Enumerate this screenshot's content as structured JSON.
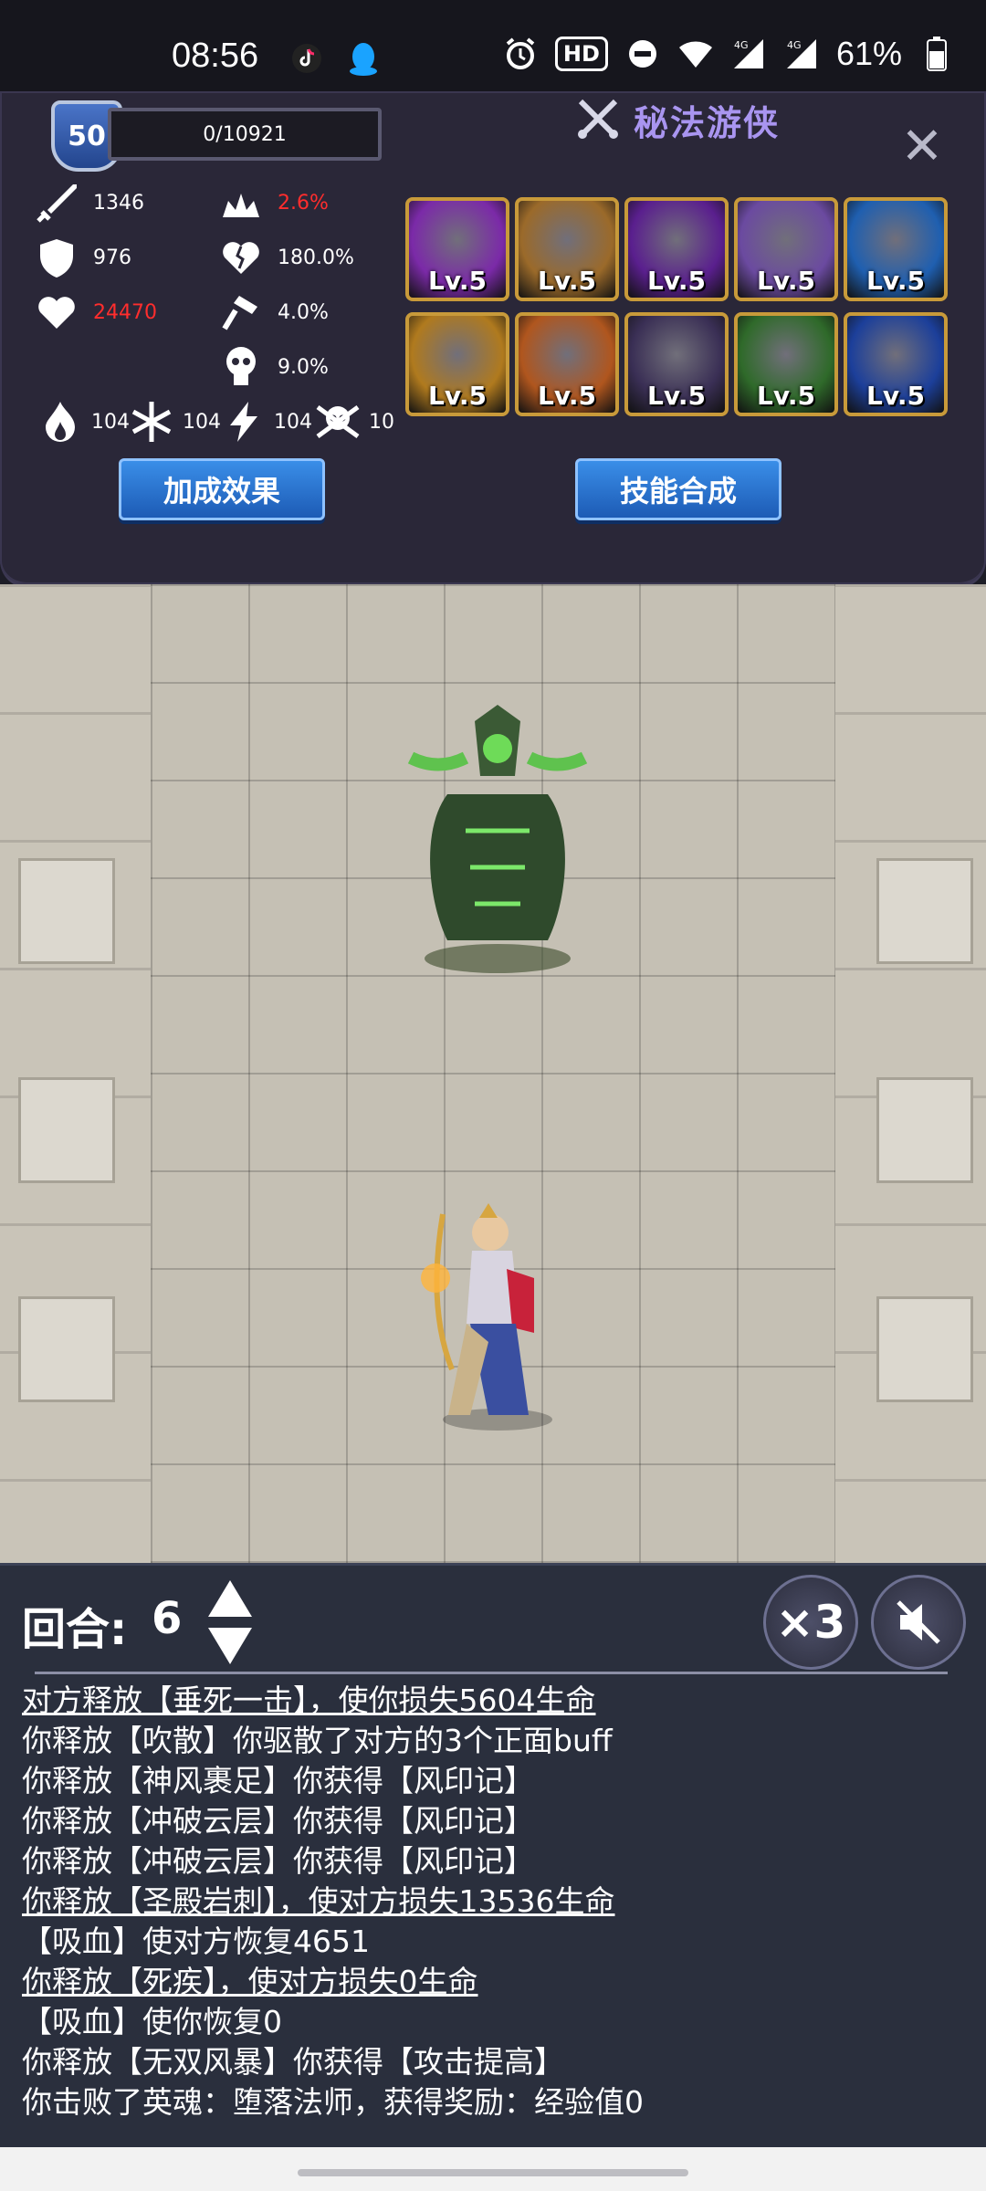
{
  "status_bar": {
    "time": "08:56",
    "hd_badge": "HD",
    "network_1": "4G",
    "network_2": "4G",
    "battery": "61%"
  },
  "profile": {
    "level": "50",
    "xp": "0/10921",
    "class_name": "秘法游侠"
  },
  "stats": {
    "attack": "1346",
    "defense": "976",
    "hp": "24470",
    "crit_rate": "2.6%",
    "lifesteal": "180.0%",
    "stat_3": "4.0%",
    "stat_4": "9.0%",
    "fire": "104",
    "ice": "104",
    "lightning": "104",
    "poison": "10"
  },
  "skills": [
    {
      "label": "Lv.5",
      "color": "#7b2aa8"
    },
    {
      "label": "Lv.5",
      "color": "#9b6a2a"
    },
    {
      "label": "Lv.5",
      "color": "#5a1f8e"
    },
    {
      "label": "Lv.5",
      "color": "#6b4aa0"
    },
    {
      "label": "Lv.5",
      "color": "#1f5fb0"
    },
    {
      "label": "Lv.5",
      "color": "#b07a1e"
    },
    {
      "label": "Lv.5",
      "color": "#b0561e"
    },
    {
      "label": "Lv.5",
      "color": "#3a2f55"
    },
    {
      "label": "Lv.5",
      "color": "#2f6a2a"
    },
    {
      "label": "Lv.5",
      "color": "#1c3f9a"
    }
  ],
  "buttons": {
    "bonus": "加成效果",
    "synthesis": "技能合成"
  },
  "battle": {
    "round_label": "回合:",
    "round_value": "6",
    "speed": "×3"
  },
  "log": [
    {
      "text": "对方释放【垂死一击】，使你损失5604生命",
      "u": true
    },
    {
      "text": "你释放【吹散】你驱散了对方的3个正面buff",
      "u": false
    },
    {
      "text": "你释放【神风裹足】你获得【风印记】",
      "u": false
    },
    {
      "text": "你释放【冲破云层】你获得【风印记】",
      "u": false
    },
    {
      "text": "你释放【冲破云层】你获得【风印记】",
      "u": false
    },
    {
      "text": "你释放【圣殿岩刺】，使对方损失13536生命",
      "u": true
    },
    {
      "text": "【吸血】使对方恢复4651",
      "u": false
    },
    {
      "text": "你释放【死疾】，使对方损失0生命",
      "u": true
    },
    {
      "text": "【吸血】使你恢复0",
      "u": false
    },
    {
      "text": "你释放【无双风暴】你获得【攻击提高】",
      "u": false
    },
    {
      "text": "你击败了英魂：堕落法师，获得奖励：经验值0",
      "u": false
    }
  ]
}
